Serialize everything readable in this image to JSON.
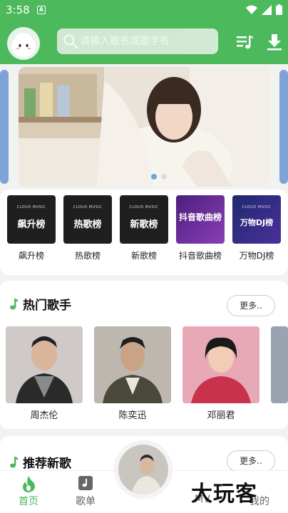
{
  "status_bar": {
    "time": "3:58",
    "notification_icon": "A"
  },
  "header": {
    "search_placeholder": "请输入歌名或歌手名"
  },
  "banner": {
    "slides": 2,
    "active_slide": 1
  },
  "rank_lists": [
    {
      "cover_brand": "CLOUD MUSIC",
      "cover_title": "飙升榜",
      "label": "飙升榜",
      "color": "#1f1f1f"
    },
    {
      "cover_brand": "CLOUD MUSIC",
      "cover_title": "热歌榜",
      "label": "热歌榜",
      "color": "#1f1f1f"
    },
    {
      "cover_brand": "CLOUD MUSIC",
      "cover_title": "新歌榜",
      "label": "新歌榜",
      "color": "#1f1f1f"
    },
    {
      "cover_brand": "",
      "cover_title": "抖音歌曲榜",
      "label": "抖音歌曲榜",
      "color": "#5a2a8c"
    },
    {
      "cover_brand": "CLOUD MUSIC",
      "cover_title": "万物DJ榜",
      "label": "万物DJ榜",
      "color": "#2a2f7a"
    }
  ],
  "hot_singers": {
    "title": "热门歌手",
    "more_label": "更多..",
    "singers": [
      {
        "name": "周杰伦",
        "bg": "#c9c2c2"
      },
      {
        "name": "陈奕迅",
        "bg": "#b9b4ae"
      },
      {
        "name": "邓丽君",
        "bg": "#e8a4b4"
      }
    ]
  },
  "new_songs": {
    "title": "推荐新歌",
    "more_label": "更多.."
  },
  "tabs": [
    {
      "label": "首页",
      "active": true
    },
    {
      "label": "歌单",
      "active": false
    },
    {
      "label": "MV",
      "active": false
    },
    {
      "label": "我的",
      "active": false
    }
  ],
  "watermark": "大玩客",
  "colors": {
    "accent": "#4cba5c",
    "dot_active": "#63a8e6"
  }
}
